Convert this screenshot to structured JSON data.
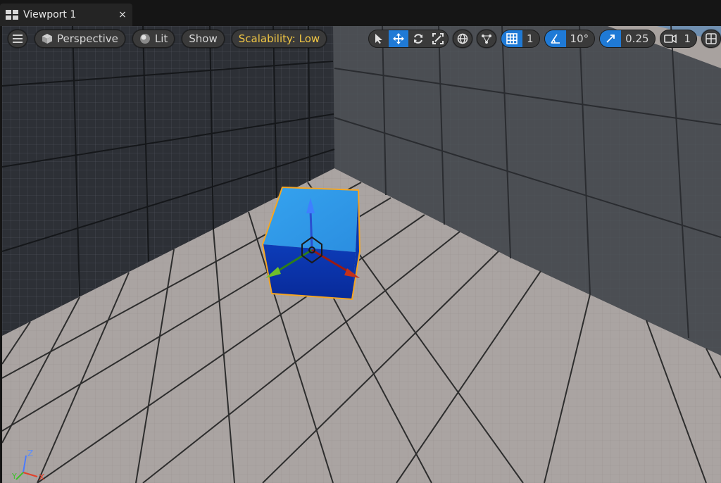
{
  "tab": {
    "title": "Viewport 1",
    "close_glyph": "×",
    "icon": "layout-grid-icon"
  },
  "toolbar": {
    "menu_icon": "hamburger-menu-icon",
    "view_mode_label": "Perspective",
    "lighting_label": "Lit",
    "show_label": "Show",
    "scalability_label": "Scalability: Low",
    "transform_tools": [
      "select-icon",
      "move-icon",
      "rotate-icon",
      "scale-icon"
    ],
    "active_tool": "move",
    "grid_snap_value": "1",
    "rotation_snap_value": "10°",
    "scale_snap_value": "0.25",
    "camera_speed_value": "1"
  },
  "axis_indicator": {
    "z": "Z",
    "y": "Y",
    "x": "X"
  },
  "colors": {
    "accent": "#1f7ad6",
    "scalability": "#f2c744",
    "selection": "#f5a623",
    "cube_top": "#2e9bea",
    "cube_side": "#0a33a8"
  }
}
